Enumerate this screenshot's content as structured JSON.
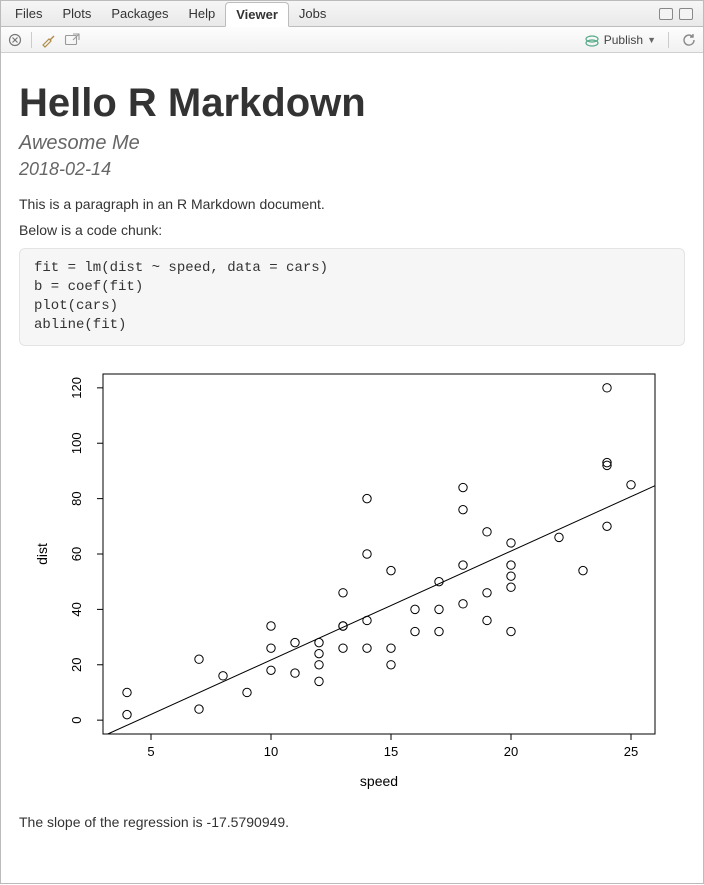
{
  "tabs": {
    "files": "Files",
    "plots": "Plots",
    "packages": "Packages",
    "help": "Help",
    "viewer": "Viewer",
    "jobs": "Jobs"
  },
  "toolbar": {
    "publish": "Publish"
  },
  "doc": {
    "title": "Hello R Markdown",
    "author": "Awesome Me",
    "date": "2018-02-14",
    "para1": "This is a paragraph in an R Markdown document.",
    "para2": "Below is a code chunk:",
    "code": "fit = lm(dist ~ speed, data = cars)\nb = coef(fit)\nplot(cars)\nabline(fit)",
    "footer": "The slope of the regression is -17.5790949."
  },
  "chart_data": {
    "type": "scatter",
    "xlabel": "speed",
    "ylabel": "dist",
    "xlim": [
      3,
      26
    ],
    "ylim": [
      -5,
      125
    ],
    "x_ticks": [
      5,
      10,
      15,
      20,
      25
    ],
    "y_ticks": [
      0,
      20,
      40,
      60,
      80,
      100,
      120
    ],
    "abline": {
      "intercept": -17.5790949,
      "slope": 3.9324088
    },
    "points": [
      {
        "x": 4,
        "y": 2
      },
      {
        "x": 4,
        "y": 10
      },
      {
        "x": 7,
        "y": 4
      },
      {
        "x": 7,
        "y": 22
      },
      {
        "x": 8,
        "y": 16
      },
      {
        "x": 9,
        "y": 10
      },
      {
        "x": 10,
        "y": 18
      },
      {
        "x": 10,
        "y": 26
      },
      {
        "x": 10,
        "y": 34
      },
      {
        "x": 11,
        "y": 17
      },
      {
        "x": 11,
        "y": 28
      },
      {
        "x": 12,
        "y": 14
      },
      {
        "x": 12,
        "y": 20
      },
      {
        "x": 12,
        "y": 24
      },
      {
        "x": 12,
        "y": 28
      },
      {
        "x": 13,
        "y": 26
      },
      {
        "x": 13,
        "y": 34
      },
      {
        "x": 13,
        "y": 34
      },
      {
        "x": 13,
        "y": 46
      },
      {
        "x": 14,
        "y": 26
      },
      {
        "x": 14,
        "y": 36
      },
      {
        "x": 14,
        "y": 60
      },
      {
        "x": 14,
        "y": 80
      },
      {
        "x": 15,
        "y": 20
      },
      {
        "x": 15,
        "y": 26
      },
      {
        "x": 15,
        "y": 54
      },
      {
        "x": 16,
        "y": 32
      },
      {
        "x": 16,
        "y": 40
      },
      {
        "x": 17,
        "y": 32
      },
      {
        "x": 17,
        "y": 40
      },
      {
        "x": 17,
        "y": 50
      },
      {
        "x": 18,
        "y": 42
      },
      {
        "x": 18,
        "y": 56
      },
      {
        "x": 18,
        "y": 76
      },
      {
        "x": 18,
        "y": 84
      },
      {
        "x": 19,
        "y": 36
      },
      {
        "x": 19,
        "y": 46
      },
      {
        "x": 19,
        "y": 68
      },
      {
        "x": 20,
        "y": 32
      },
      {
        "x": 20,
        "y": 48
      },
      {
        "x": 20,
        "y": 52
      },
      {
        "x": 20,
        "y": 56
      },
      {
        "x": 20,
        "y": 64
      },
      {
        "x": 22,
        "y": 66
      },
      {
        "x": 23,
        "y": 54
      },
      {
        "x": 24,
        "y": 70
      },
      {
        "x": 24,
        "y": 92
      },
      {
        "x": 24,
        "y": 93
      },
      {
        "x": 24,
        "y": 120
      },
      {
        "x": 25,
        "y": 85
      }
    ]
  }
}
